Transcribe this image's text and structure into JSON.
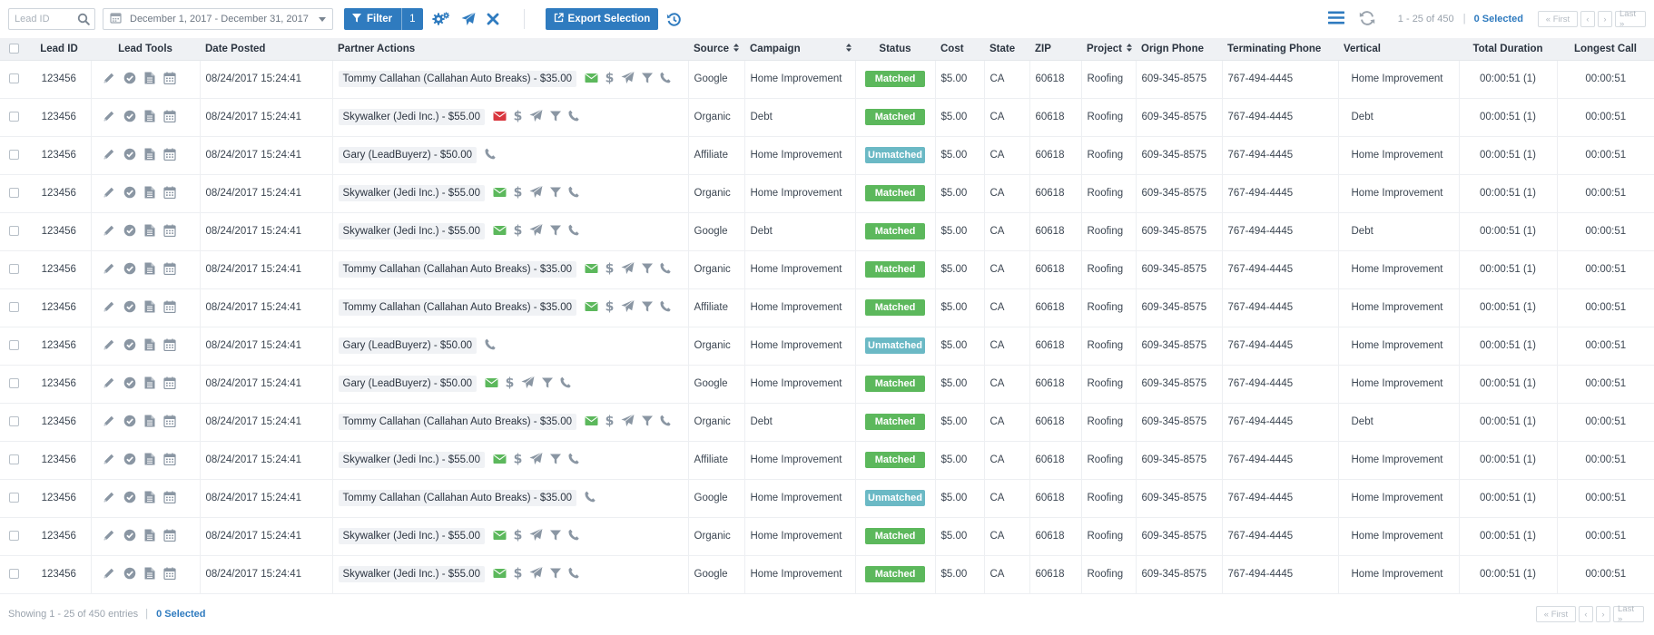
{
  "toolbar": {
    "lead_id_placeholder": "Lead ID",
    "date_range": "December 1, 2017 - December 31, 2017",
    "filter_label": "Filter",
    "filter_count": "1",
    "export_label": "Export Selection",
    "page_info": "1 - 25 of 450",
    "selected": "0 Selected",
    "pager": {
      "first": "« First",
      "prev": "‹",
      "next": "›",
      "last": "Last »"
    }
  },
  "columns": {
    "lead_id": "Lead ID",
    "lead_tools": "Lead Tools",
    "date_posted": "Date Posted",
    "partner_actions": "Partner Actions",
    "source": "Source",
    "campaign": "Campaign",
    "status": "Status",
    "cost": "Cost",
    "state": "State",
    "zip": "ZIP",
    "project": "Project",
    "origin_phone": "Orign Phone",
    "terminating_phone": "Terminating Phone",
    "vertical": "Vertical",
    "total_duration": "Total Duration",
    "longest_call": "Longest Call"
  },
  "status_colors": {
    "Matched": "#5cb85c",
    "Unmatched": "#6bb9c5"
  },
  "colors": {
    "primary": "#2f7bbf",
    "icon_gray": "#8a96a3",
    "email_green": "#5cb85c",
    "email_red": "#d9363e"
  },
  "rows": [
    {
      "lead_id": "123456",
      "date": "08/24/2017 15:24:41",
      "partner": "Tommy Callahan (Callahan Auto Breaks) - $35.00",
      "actions": [
        "email",
        "dollar",
        "send",
        "filter",
        "phone"
      ],
      "email": "green",
      "source": "Google",
      "campaign": "Home Improvement",
      "status": "Matched",
      "cost": "$5.00",
      "state": "CA",
      "zip": "60618",
      "project": "Roofing",
      "origin_phone": "609-345-8575",
      "terminating_phone": "767-494-4445",
      "vertical": "Home Improvement",
      "total_duration": "00:00:51 (1)",
      "longest_call": "00:00:51"
    },
    {
      "lead_id": "123456",
      "date": "08/24/2017 15:24:41",
      "partner": "Skywalker (Jedi Inc.) - $55.00",
      "actions": [
        "email",
        "dollar",
        "send",
        "filter",
        "phone"
      ],
      "email": "red",
      "source": "Organic",
      "campaign": "Debt",
      "status": "Matched",
      "cost": "$5.00",
      "state": "CA",
      "zip": "60618",
      "project": "Roofing",
      "origin_phone": "609-345-8575",
      "terminating_phone": "767-494-4445",
      "vertical": "Debt",
      "total_duration": "00:00:51 (1)",
      "longest_call": "00:00:51"
    },
    {
      "lead_id": "123456",
      "date": "08/24/2017 15:24:41",
      "partner": "Gary (LeadBuyerz) - $50.00",
      "actions": [
        "phone"
      ],
      "email": "green",
      "source": "Affiliate",
      "campaign": "Home Improvement",
      "status": "Unmatched",
      "cost": "$5.00",
      "state": "CA",
      "zip": "60618",
      "project": "Roofing",
      "origin_phone": "609-345-8575",
      "terminating_phone": "767-494-4445",
      "vertical": "Home Improvement",
      "total_duration": "00:00:51 (1)",
      "longest_call": "00:00:51"
    },
    {
      "lead_id": "123456",
      "date": "08/24/2017 15:24:41",
      "partner": "Skywalker (Jedi Inc.) - $55.00",
      "actions": [
        "email",
        "dollar",
        "send",
        "filter",
        "phone"
      ],
      "email": "green",
      "source": "Organic",
      "campaign": "Home Improvement",
      "status": "Matched",
      "cost": "$5.00",
      "state": "CA",
      "zip": "60618",
      "project": "Roofing",
      "origin_phone": "609-345-8575",
      "terminating_phone": "767-494-4445",
      "vertical": "Home Improvement",
      "total_duration": "00:00:51 (1)",
      "longest_call": "00:00:51"
    },
    {
      "lead_id": "123456",
      "date": "08/24/2017 15:24:41",
      "partner": "Skywalker (Jedi Inc.) - $55.00",
      "actions": [
        "email",
        "dollar",
        "send",
        "filter",
        "phone"
      ],
      "email": "green",
      "source": "Google",
      "campaign": "Debt",
      "status": "Matched",
      "cost": "$5.00",
      "state": "CA",
      "zip": "60618",
      "project": "Roofing",
      "origin_phone": "609-345-8575",
      "terminating_phone": "767-494-4445",
      "vertical": "Debt",
      "total_duration": "00:00:51 (1)",
      "longest_call": "00:00:51"
    },
    {
      "lead_id": "123456",
      "date": "08/24/2017 15:24:41",
      "partner": "Tommy Callahan (Callahan Auto Breaks) - $35.00",
      "actions": [
        "email",
        "dollar",
        "send",
        "filter",
        "phone"
      ],
      "email": "green",
      "source": "Organic",
      "campaign": "Home Improvement",
      "status": "Matched",
      "cost": "$5.00",
      "state": "CA",
      "zip": "60618",
      "project": "Roofing",
      "origin_phone": "609-345-8575",
      "terminating_phone": "767-494-4445",
      "vertical": "Home Improvement",
      "total_duration": "00:00:51 (1)",
      "longest_call": "00:00:51"
    },
    {
      "lead_id": "123456",
      "date": "08/24/2017 15:24:41",
      "partner": "Tommy Callahan (Callahan Auto Breaks) - $35.00",
      "actions": [
        "email",
        "dollar",
        "send",
        "filter",
        "phone"
      ],
      "email": "green",
      "source": "Affiliate",
      "campaign": "Home Improvement",
      "status": "Matched",
      "cost": "$5.00",
      "state": "CA",
      "zip": "60618",
      "project": "Roofing",
      "origin_phone": "609-345-8575",
      "terminating_phone": "767-494-4445",
      "vertical": "Home Improvement",
      "total_duration": "00:00:51 (1)",
      "longest_call": "00:00:51"
    },
    {
      "lead_id": "123456",
      "date": "08/24/2017 15:24:41",
      "partner": "Gary (LeadBuyerz) - $50.00",
      "actions": [
        "phone"
      ],
      "email": "green",
      "source": "Organic",
      "campaign": "Home Improvement",
      "status": "Unmatched",
      "cost": "$5.00",
      "state": "CA",
      "zip": "60618",
      "project": "Roofing",
      "origin_phone": "609-345-8575",
      "terminating_phone": "767-494-4445",
      "vertical": "Home Improvement",
      "total_duration": "00:00:51 (1)",
      "longest_call": "00:00:51"
    },
    {
      "lead_id": "123456",
      "date": "08/24/2017 15:24:41",
      "partner": "Gary (LeadBuyerz) - $50.00",
      "actions": [
        "email",
        "dollar",
        "send",
        "filter",
        "phone"
      ],
      "email": "green",
      "source": "Google",
      "campaign": "Home Improvement",
      "status": "Matched",
      "cost": "$5.00",
      "state": "CA",
      "zip": "60618",
      "project": "Roofing",
      "origin_phone": "609-345-8575",
      "terminating_phone": "767-494-4445",
      "vertical": "Home Improvement",
      "total_duration": "00:00:51 (1)",
      "longest_call": "00:00:51"
    },
    {
      "lead_id": "123456",
      "date": "08/24/2017 15:24:41",
      "partner": "Tommy Callahan (Callahan Auto Breaks) - $35.00",
      "actions": [
        "email",
        "dollar",
        "send",
        "filter",
        "phone"
      ],
      "email": "green",
      "source": "Organic",
      "campaign": "Debt",
      "status": "Matched",
      "cost": "$5.00",
      "state": "CA",
      "zip": "60618",
      "project": "Roofing",
      "origin_phone": "609-345-8575",
      "terminating_phone": "767-494-4445",
      "vertical": "Debt",
      "total_duration": "00:00:51 (1)",
      "longest_call": "00:00:51"
    },
    {
      "lead_id": "123456",
      "date": "08/24/2017 15:24:41",
      "partner": "Skywalker (Jedi Inc.) - $55.00",
      "actions": [
        "email",
        "dollar",
        "send",
        "filter",
        "phone"
      ],
      "email": "green",
      "source": "Affiliate",
      "campaign": "Home Improvement",
      "status": "Matched",
      "cost": "$5.00",
      "state": "CA",
      "zip": "60618",
      "project": "Roofing",
      "origin_phone": "609-345-8575",
      "terminating_phone": "767-494-4445",
      "vertical": "Home Improvement",
      "total_duration": "00:00:51 (1)",
      "longest_call": "00:00:51"
    },
    {
      "lead_id": "123456",
      "date": "08/24/2017 15:24:41",
      "partner": "Tommy Callahan (Callahan Auto Breaks) - $35.00",
      "actions": [
        "phone"
      ],
      "email": "green",
      "source": "Google",
      "campaign": "Home Improvement",
      "status": "Unmatched",
      "cost": "$5.00",
      "state": "CA",
      "zip": "60618",
      "project": "Roofing",
      "origin_phone": "609-345-8575",
      "terminating_phone": "767-494-4445",
      "vertical": "Home Improvement",
      "total_duration": "00:00:51 (1)",
      "longest_call": "00:00:51"
    },
    {
      "lead_id": "123456",
      "date": "08/24/2017 15:24:41",
      "partner": "Skywalker (Jedi Inc.) - $55.00",
      "actions": [
        "email",
        "dollar",
        "send",
        "filter",
        "phone"
      ],
      "email": "green",
      "source": "Organic",
      "campaign": "Home Improvement",
      "status": "Matched",
      "cost": "$5.00",
      "state": "CA",
      "zip": "60618",
      "project": "Roofing",
      "origin_phone": "609-345-8575",
      "terminating_phone": "767-494-4445",
      "vertical": "Home Improvement",
      "total_duration": "00:00:51 (1)",
      "longest_call": "00:00:51"
    },
    {
      "lead_id": "123456",
      "date": "08/24/2017 15:24:41",
      "partner": "Skywalker (Jedi Inc.) - $55.00",
      "actions": [
        "email",
        "dollar",
        "send",
        "filter",
        "phone"
      ],
      "email": "green",
      "source": "Google",
      "campaign": "Home Improvement",
      "status": "Matched",
      "cost": "$5.00",
      "state": "CA",
      "zip": "60618",
      "project": "Roofing",
      "origin_phone": "609-345-8575",
      "terminating_phone": "767-494-4445",
      "vertical": "Home Improvement",
      "total_duration": "00:00:51 (1)",
      "longest_call": "00:00:51"
    }
  ],
  "footer": {
    "showing": "Showing 1 - 25 of 450 entries",
    "selected": "0 Selected",
    "pager": {
      "first": "« First",
      "prev": "‹",
      "next": "›",
      "last": "Last »"
    }
  }
}
